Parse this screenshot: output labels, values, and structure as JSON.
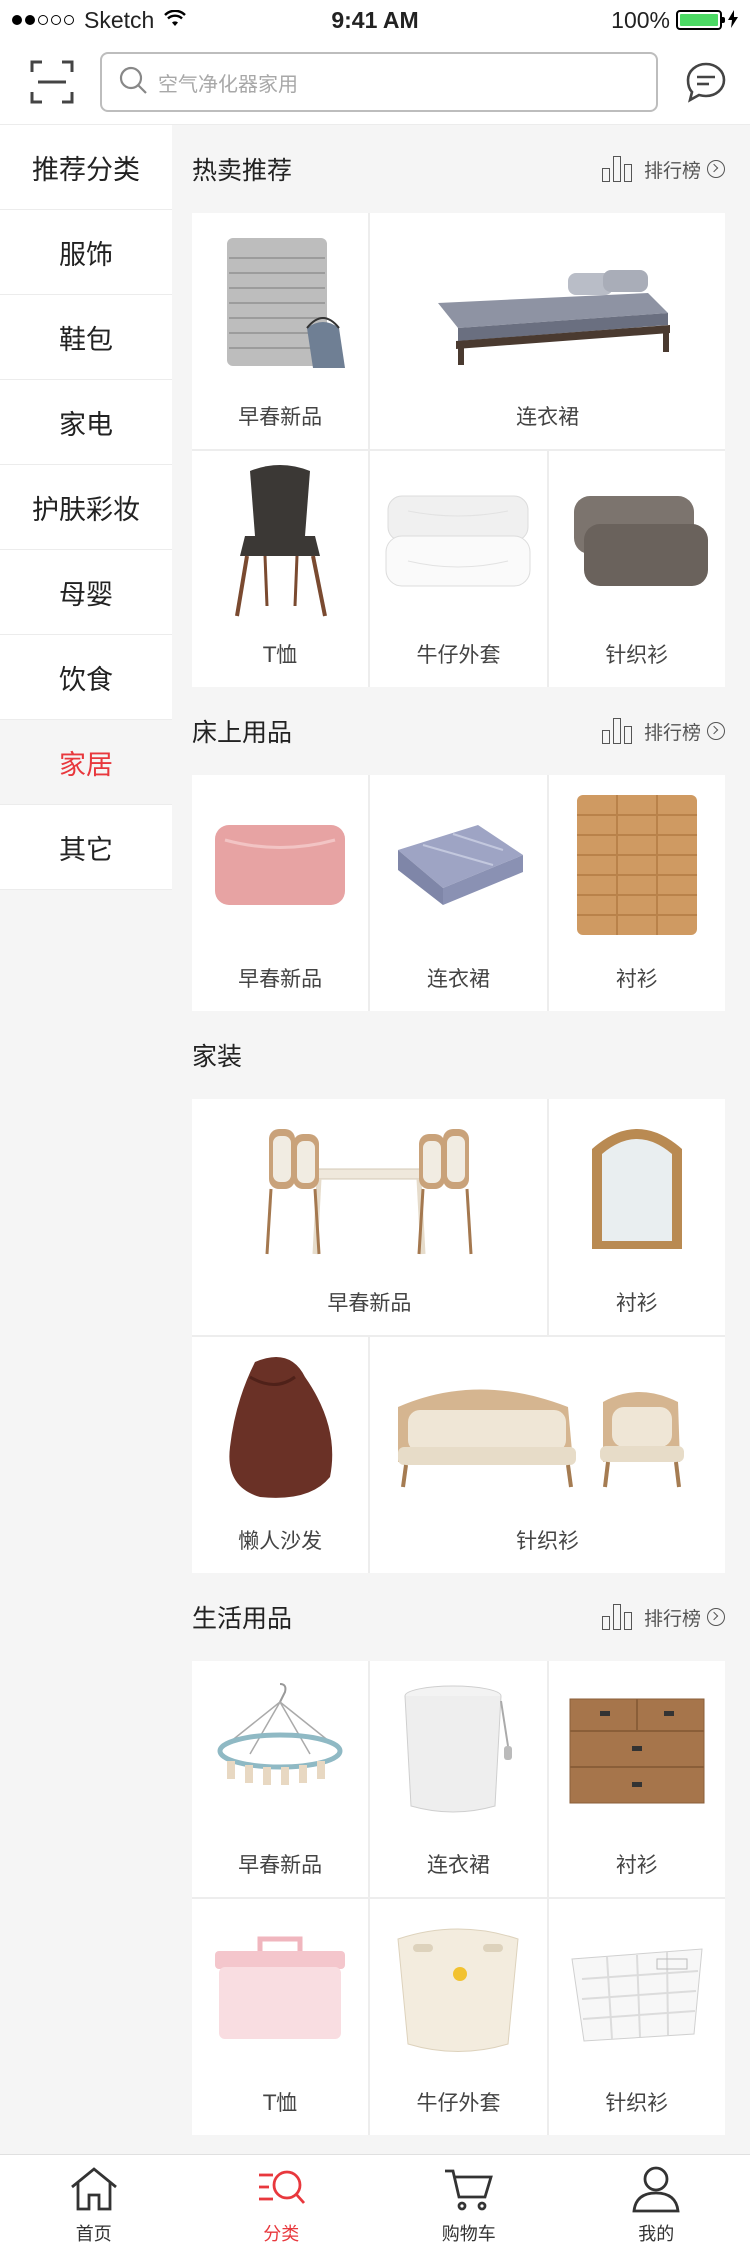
{
  "status_bar": {
    "carrier": "Sketch",
    "time": "9:41 AM",
    "battery": "100%"
  },
  "header": {
    "search_placeholder": "空气净化器家用"
  },
  "sidebar": {
    "items": [
      {
        "label": "推荐分类"
      },
      {
        "label": "服饰"
      },
      {
        "label": "鞋包"
      },
      {
        "label": "家电"
      },
      {
        "label": "护肤彩妆"
      },
      {
        "label": "母婴"
      },
      {
        "label": "饮食"
      },
      {
        "label": "家居"
      },
      {
        "label": "其它"
      }
    ],
    "active_index": 7
  },
  "sections": {
    "hot": {
      "title": "热卖推荐",
      "rank_label": "排行榜",
      "items": [
        "早春新品",
        "连衣裙",
        "T恤",
        "牛仔外套",
        "针织衫"
      ]
    },
    "bedding": {
      "title": "床上用品",
      "rank_label": "排行榜",
      "items": [
        "早春新品",
        "连衣裙",
        "衬衫"
      ]
    },
    "furniture": {
      "title": "家装",
      "items": [
        "早春新品",
        "衬衫",
        "懒人沙发",
        "针织衫"
      ]
    },
    "living": {
      "title": "生活用品",
      "rank_label": "排行榜",
      "items": [
        "早春新品",
        "连衣裙",
        "衬衫",
        "T恤",
        "牛仔外套",
        "针织衫"
      ]
    }
  },
  "tabbar": {
    "items": [
      {
        "label": "首页"
      },
      {
        "label": "分类"
      },
      {
        "label": "购物车"
      },
      {
        "label": "我的"
      }
    ],
    "active_index": 1
  },
  "colors": {
    "accent": "#e8383d",
    "battery": "#4cd964"
  }
}
